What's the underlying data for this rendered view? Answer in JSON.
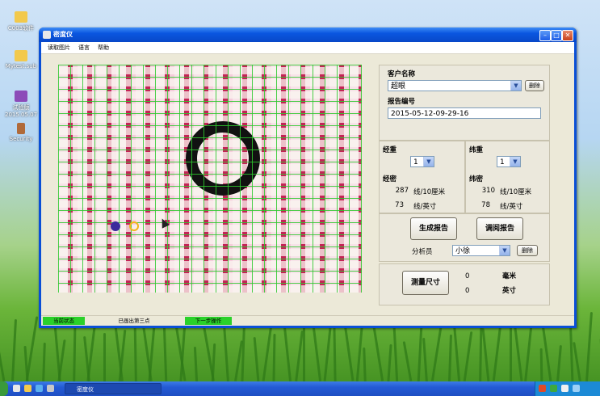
{
  "desktop": {
    "icons": [
      {
        "label": "C003软件"
      },
      {
        "label": "Mytest.sub"
      },
      {
        "label": "试验版\n2015.05.07"
      },
      {
        "label": "Security"
      }
    ]
  },
  "window": {
    "title": "密度仪",
    "menu": [
      "读取图片",
      "语言",
      "帮助"
    ]
  },
  "customer": {
    "label": "客户名称",
    "value": "超眼",
    "delete_label": "删除"
  },
  "report": {
    "label": "报告编号",
    "value": "2015-05-12-09-29-16"
  },
  "warp": {
    "weight_label": "经重",
    "weight_value": "1",
    "density_label": "经密",
    "density_cm": "287",
    "density_cm_unit": "线/10厘米",
    "density_in": "73",
    "density_in_unit": "线/英寸"
  },
  "weft": {
    "weight_label": "纬重",
    "weight_value": "1",
    "density_label": "纬密",
    "density_cm": "310",
    "density_cm_unit": "线/10厘米",
    "density_in": "78",
    "density_in_unit": "线/英寸"
  },
  "actions": {
    "generate_report": "生成报告",
    "view_report": "调阅报告"
  },
  "analyst": {
    "label": "分析员",
    "value": "小徐",
    "delete_label": "删除"
  },
  "measure": {
    "button": "测量尺寸",
    "mm_value": "0",
    "mm_unit": "毫米",
    "in_value": "0",
    "in_unit": "英寸"
  },
  "status": {
    "state_label": "当前状态",
    "message": "已画出第三点",
    "next_label": "下一步操作"
  },
  "taskbar": {
    "task_label": "密度仪"
  },
  "colors": {
    "status_green": "#2ad12a",
    "grid_green": "#2dc82d",
    "fabric_red": "#c4225a"
  }
}
